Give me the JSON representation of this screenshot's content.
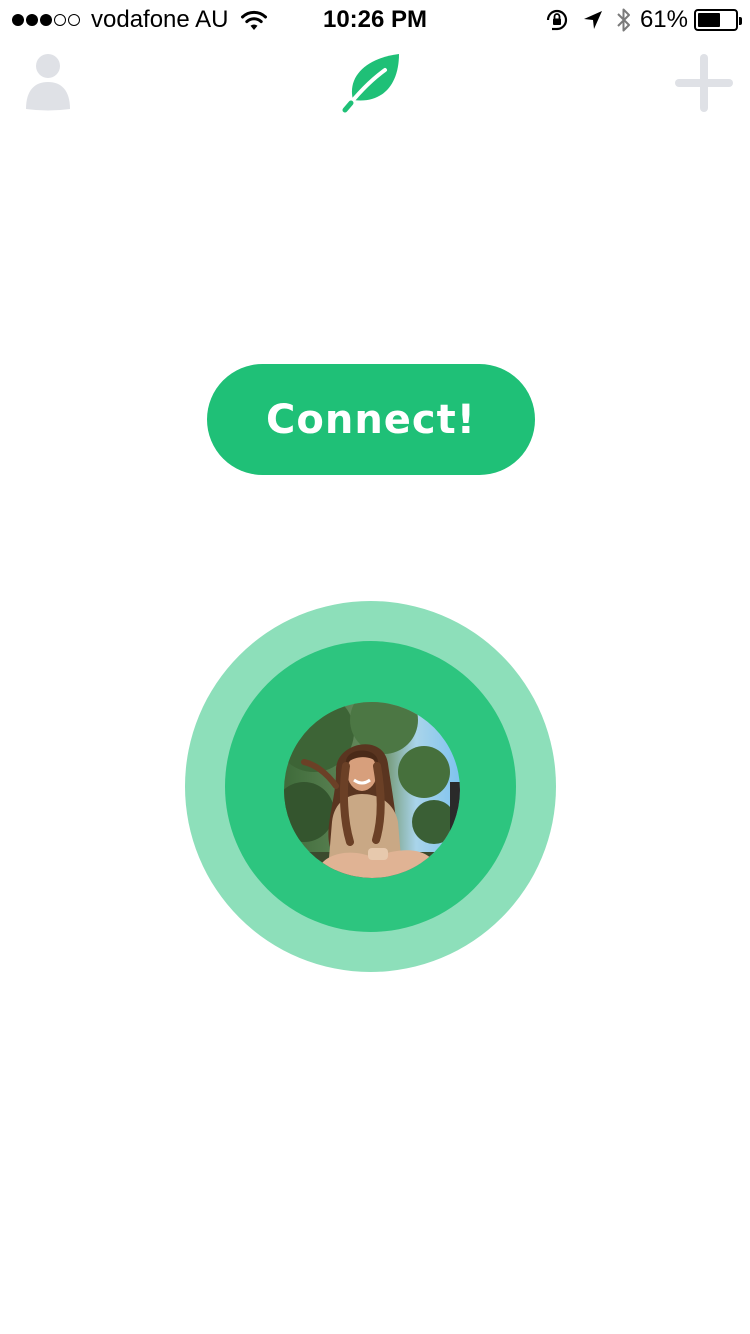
{
  "status_bar": {
    "signal_filled": 3,
    "signal_total": 5,
    "carrier": "vodafone AU",
    "time": "10:26 PM",
    "battery_percent_label": "61%",
    "battery_level": 0.61,
    "icons": [
      "wifi-icon",
      "orientation-lock-icon",
      "location-arrow-icon",
      "bluetooth-icon",
      "battery-icon"
    ]
  },
  "nav": {
    "left_icon": "profile-icon",
    "center_icon": "leaf-logo-icon",
    "right_icon": "plus-icon"
  },
  "main": {
    "connect_label": "Connect!",
    "avatar": "user-photo"
  },
  "colors": {
    "brand_green": "#1fc077",
    "ring_outer": "#8ddfba",
    "ring_inner": "#2dc57f",
    "nav_icon_gray": "#dfe1e6"
  }
}
